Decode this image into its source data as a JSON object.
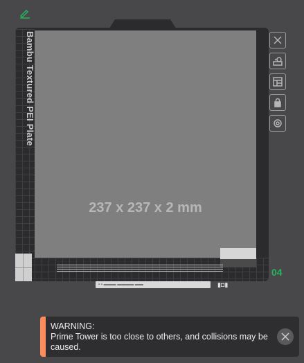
{
  "plate": {
    "name": "Bambu Textured PEI Plate",
    "size_text": "237 x 237 x 2 mm",
    "index": "04",
    "index_color": "#25b35b"
  },
  "toolbar": {
    "items": [
      {
        "icon": "close-icon",
        "label": "Delete plate"
      },
      {
        "icon": "arrange-icon",
        "label": "Arrange"
      },
      {
        "icon": "layout-icon",
        "label": "Plate settings"
      },
      {
        "icon": "lock-icon",
        "label": "Lock"
      },
      {
        "icon": "settings-icon",
        "label": "Settings"
      }
    ]
  },
  "warning": {
    "accent_color": "#ff8c5a",
    "title": "WARNING:",
    "message": "Prime Tower is too close to others, and collisions may be caused."
  },
  "edit_icon_color": "#25b35b"
}
